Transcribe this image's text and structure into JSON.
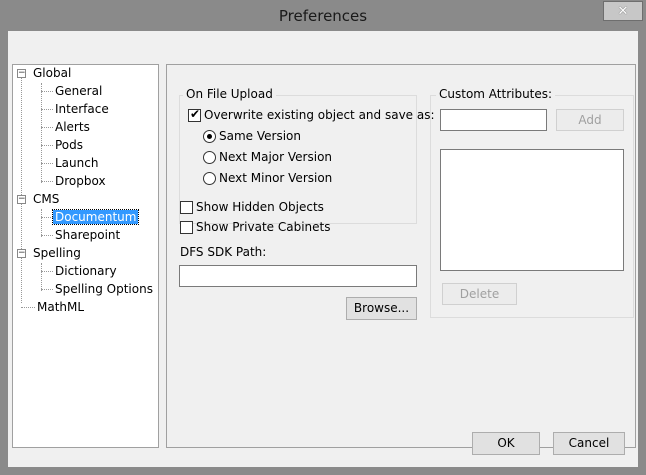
{
  "window": {
    "title": "Preferences",
    "close_glyph": "✕",
    "close_icon": "close-icon"
  },
  "tree": {
    "items": [
      {
        "label": "Global",
        "expander": "−"
      },
      {
        "label": "General"
      },
      {
        "label": "Interface"
      },
      {
        "label": "Alerts"
      },
      {
        "label": "Pods"
      },
      {
        "label": "Launch"
      },
      {
        "label": "Dropbox"
      },
      {
        "label": "CMS",
        "expander": "−"
      },
      {
        "label": "Documentum"
      },
      {
        "label": "Sharepoint"
      },
      {
        "label": "Spelling",
        "expander": "−"
      },
      {
        "label": "Dictionary"
      },
      {
        "label": "Spelling Options"
      },
      {
        "label": "MathML"
      }
    ],
    "selected": "Documentum"
  },
  "upload": {
    "group_label": "On File Upload",
    "overwrite_label": "Overwrite existing object and save as:",
    "overwrite_checked": true,
    "radios": [
      {
        "label": "Same Version",
        "checked": true
      },
      {
        "label": "Next Major Version",
        "checked": false
      },
      {
        "label": "Next Minor Version",
        "checked": false
      }
    ]
  },
  "options": {
    "show_hidden": "Show Hidden Objects",
    "show_private": "Show Private Cabinets"
  },
  "sdk": {
    "label": "DFS SDK Path:",
    "value": "",
    "browse": "Browse..."
  },
  "custom": {
    "label": "Custom Attributes:",
    "input_value": "",
    "add": "Add",
    "delete": "Delete"
  },
  "footer": {
    "ok": "OK",
    "cancel": "Cancel"
  },
  "check_glyph": "✔"
}
